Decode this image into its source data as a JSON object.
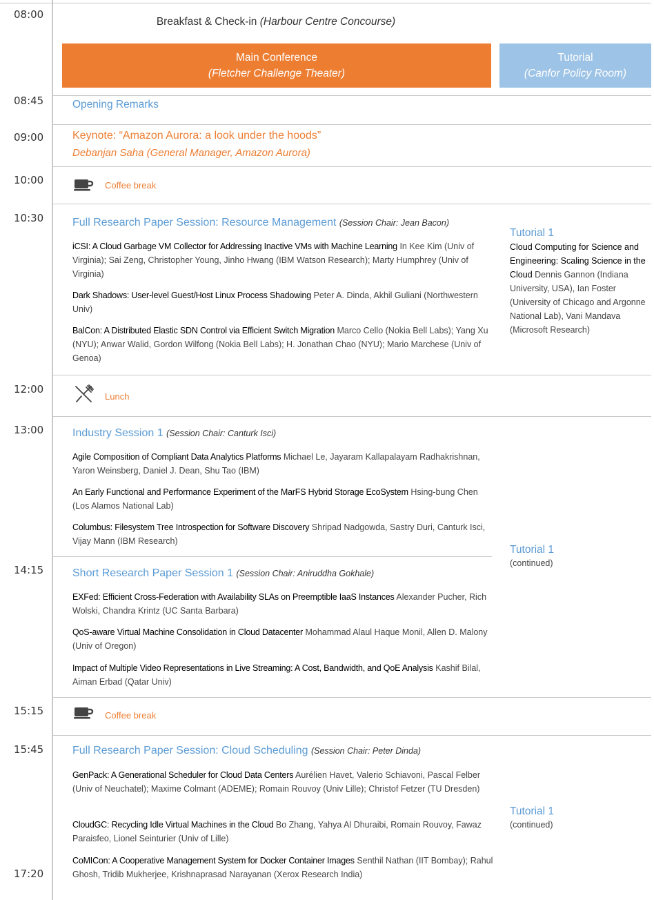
{
  "times": [
    "08:00",
    "08:45",
    "09:00",
    "10:00",
    "10:30",
    "12:00",
    "13:00",
    "14:15",
    "15:15",
    "15:45",
    "17:20"
  ],
  "breakfast": {
    "label": "Breakfast & Check-in",
    "location": "(Harbour Centre Concourse)"
  },
  "tracks": {
    "main": {
      "label": "Main Conference",
      "location": "(Fletcher Challenge Theater)"
    },
    "tutorial": {
      "label": "Tutorial",
      "location": "(Canfor Policy Room)"
    }
  },
  "opening": "Opening Remarks",
  "keynote": {
    "title": "Keynote: “Amazon Aurora: a look under the hoods”",
    "speaker": "Debanjan Saha (General Manager, Amazon Aurora)"
  },
  "coffee1": "Coffee break",
  "lunch": "Lunch",
  "coffee2": "Coffee break",
  "session1": {
    "title": "Full Research Paper Session: Resource Management",
    "chair": "(Session Chair: Jean Bacon)",
    "papers": [
      {
        "title": "iCSI: A Cloud Garbage VM Collector for Addressing Inactive VMs with Machine Learning",
        "authors": "In Kee Kim (Univ of Virginia); Sai Zeng, Christopher Young, Jinho Hwang (IBM Watson Research); Marty Humphrey (Univ of Virginia)"
      },
      {
        "title": "Dark Shadows: User-level Guest/Host Linux Process Shadowing",
        "authors": "Peter A. Dinda, Akhil Guliani (Northwestern Univ)"
      },
      {
        "title": "BalCon: A Distributed Elastic SDN Control via Efficient Switch Migration",
        "authors": "Marco Cello (Nokia Bell Labs); Yang Xu (NYU); Anwar Walid, Gordon Wilfong (Nokia Bell Labs); H. Jonathan Chao (NYU); Mario Marchese (Univ of Genoa)"
      }
    ]
  },
  "tutorial1": {
    "title": "Tutorial 1",
    "name": "Cloud Computing for Science and Engineering: Scaling Science in the Cloud",
    "presenters": "Dennis Gannon (Indiana University, USA), Ian Foster (University of Chicago and Argonne National Lab), Vani Mandava (Microsoft Research)"
  },
  "tutorial_cont": {
    "title": "Tutorial 1",
    "note": "(continued)"
  },
  "industry": {
    "title": "Industry Session 1",
    "chair": "(Session Chair: Canturk Isci)",
    "papers": [
      {
        "title": "Agile Composition of Compliant Data Analytics Platforms",
        "authors": "Michael Le, Jayaram Kallapalayam Radhakrishnan, Yaron Weinsberg, Daniel J. Dean, Shu Tao (IBM)"
      },
      {
        "title": "An Early Functional and Performance Experiment of the MarFS Hybrid Storage EcoSystem",
        "authors": "Hsing-bung Chen (Los Alamos National Lab)"
      },
      {
        "title": "Columbus: Filesystem Tree Introspection for Software Discovery",
        "authors": "Shripad Nadgowda, Sastry Duri, Canturk Isci, Vijay Mann (IBM Research)"
      }
    ]
  },
  "short": {
    "title": "Short Research Paper Session 1",
    "chair": "(Session Chair: Aniruddha Gokhale)",
    "papers": [
      {
        "title": "EXFed: Efficient Cross-Federation with Availability SLAs on Preemptible IaaS Instances",
        "authors": "Alexander Pucher, Rich Wolski, Chandra Krintz (UC Santa Barbara)"
      },
      {
        "title": "QoS-aware Virtual Machine Consolidation in Cloud Datacenter",
        "authors": "Mohammad Alaul Haque Monil, Allen D. Malony (Univ of Oregon)"
      },
      {
        "title": "Impact of Multiple Video Representations in Live Streaming: A Cost, Bandwidth, and QoE Analysis",
        "authors": "Kashif Bilal, Aiman Erbad (Qatar Univ)"
      }
    ]
  },
  "session3": {
    "title": "Full Research Paper Session: Cloud Scheduling",
    "chair": "(Session Chair: Peter Dinda)",
    "papers": [
      {
        "title": "GenPack: A Generational Scheduler for Cloud Data Centers",
        "authors": "Aurélien Havet, Valerio Schiavoni, Pascal Felber (Univ of Neuchatel); Maxime Colmant (ADEME); Romain Rouvoy (Univ Lille); Christof Fetzer (TU Dresden)"
      },
      {
        "title": "CloudGC: Recycling Idle Virtual Machines in the Cloud",
        "authors": "Bo Zhang, Yahya Al Dhuraibi, Romain Rouvoy, Fawaz Paraisfeo, Lionel Seinturier (Univ of Lille)"
      },
      {
        "title": "CoMICon: A Cooperative Management System for Docker Container Images",
        "authors": "Senthil Nathan (IIT Bombay); Rahul Ghosh, Tridib Mukherjee, Krishnaprasad Narayanan (Xerox Research India)"
      }
    ]
  },
  "colors": {
    "orange": "#ed7d31",
    "blue": "#5b9bd5",
    "tutorial_box": "#9dc3e6"
  },
  "icons": [
    "coffee-cup-icon",
    "fork-knife-icon"
  ]
}
